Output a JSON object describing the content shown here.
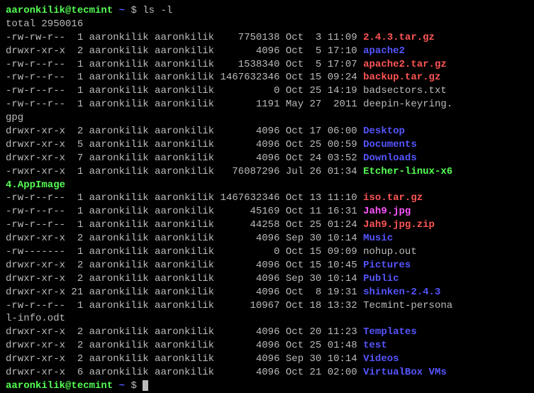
{
  "prompt": {
    "user": "aaronkilik@tecmint",
    "sep": " ",
    "tilde": "~",
    "dollar": " $ "
  },
  "command": "ls -l",
  "total": "total 2950016",
  "rows": [
    {
      "perm": "-rw-rw-r--",
      "links": " 1",
      "owner": "aaronkilik",
      "group": "aaronkilik",
      "size": "   7750138",
      "date": "Oct  3 11:09",
      "file": "2.4.3.tar.gz",
      "cls": "name-red"
    },
    {
      "perm": "drwxr-xr-x",
      "links": " 2",
      "owner": "aaronkilik",
      "group": "aaronkilik",
      "size": "      4096",
      "date": "Oct  5 17:10",
      "file": "apache2",
      "cls": "name-blue"
    },
    {
      "perm": "-rw-r--r--",
      "links": " 1",
      "owner": "aaronkilik",
      "group": "aaronkilik",
      "size": "   1538340",
      "date": "Oct  5 17:07",
      "file": "apache2.tar.gz",
      "cls": "name-red"
    },
    {
      "perm": "-rw-r--r--",
      "links": " 1",
      "owner": "aaronkilik",
      "group": "aaronkilik",
      "size": "1467632346",
      "date": "Oct 15 09:24",
      "file": "backup.tar.gz",
      "cls": "name-red"
    },
    {
      "perm": "-rw-r--r--",
      "links": " 1",
      "owner": "aaronkilik",
      "group": "aaronkilik",
      "size": "         0",
      "date": "Oct 25 14:19",
      "file": "badsectors.txt",
      "cls": "name-grey"
    },
    {
      "perm": "-rw-r--r--",
      "links": " 1",
      "owner": "aaronkilik",
      "group": "aaronkilik",
      "size": "      1191",
      "date": "May 27  2011",
      "file": "deepin-keyring.",
      "cls": "name-grey",
      "wrap": "gpg",
      "wrapcls": "name-grey"
    },
    {
      "perm": "drwxr-xr-x",
      "links": " 2",
      "owner": "aaronkilik",
      "group": "aaronkilik",
      "size": "      4096",
      "date": "Oct 17 06:00",
      "file": "Desktop",
      "cls": "name-blue"
    },
    {
      "perm": "drwxr-xr-x",
      "links": " 5",
      "owner": "aaronkilik",
      "group": "aaronkilik",
      "size": "      4096",
      "date": "Oct 25 00:59",
      "file": "Documents",
      "cls": "name-blue"
    },
    {
      "perm": "drwxr-xr-x",
      "links": " 7",
      "owner": "aaronkilik",
      "group": "aaronkilik",
      "size": "      4096",
      "date": "Oct 24 03:52",
      "file": "Downloads",
      "cls": "name-blue"
    },
    {
      "perm": "-rwxr-xr-x",
      "links": " 1",
      "owner": "aaronkilik",
      "group": "aaronkilik",
      "size": "  76087296",
      "date": "Jul 26 01:34",
      "file": "Etcher-linux-x6",
      "cls": "name-green",
      "wrap": "4.AppImage",
      "wrapcls": "name-green"
    },
    {
      "perm": "-rw-r--r--",
      "links": " 1",
      "owner": "aaronkilik",
      "group": "aaronkilik",
      "size": "1467632346",
      "date": "Oct 13 11:10",
      "file": "iso.tar.gz",
      "cls": "name-red"
    },
    {
      "perm": "-rw-r--r--",
      "links": " 1",
      "owner": "aaronkilik",
      "group": "aaronkilik",
      "size": "     45169",
      "date": "Oct 11 16:31",
      "file": "Jah9.jpg",
      "cls": "name-magenta"
    },
    {
      "perm": "-rw-r--r--",
      "links": " 1",
      "owner": "aaronkilik",
      "group": "aaronkilik",
      "size": "     44258",
      "date": "Oct 25 01:24",
      "file": "Jah9.jpg.zip",
      "cls": "name-red"
    },
    {
      "perm": "drwxr-xr-x",
      "links": " 2",
      "owner": "aaronkilik",
      "group": "aaronkilik",
      "size": "      4096",
      "date": "Sep 30 10:14",
      "file": "Music",
      "cls": "name-blue"
    },
    {
      "perm": "-rw-------",
      "links": " 1",
      "owner": "aaronkilik",
      "group": "aaronkilik",
      "size": "         0",
      "date": "Oct 15 09:09",
      "file": "nohup.out",
      "cls": "name-grey"
    },
    {
      "perm": "drwxr-xr-x",
      "links": " 2",
      "owner": "aaronkilik",
      "group": "aaronkilik",
      "size": "      4096",
      "date": "Oct 15 10:45",
      "file": "Pictures",
      "cls": "name-blue"
    },
    {
      "perm": "drwxr-xr-x",
      "links": " 2",
      "owner": "aaronkilik",
      "group": "aaronkilik",
      "size": "      4096",
      "date": "Sep 30 10:14",
      "file": "Public",
      "cls": "name-blue"
    },
    {
      "perm": "drwxr-xr-x",
      "links": "21",
      "owner": "aaronkilik",
      "group": "aaronkilik",
      "size": "      4096",
      "date": "Oct  8 19:31",
      "file": "shinken-2.4.3",
      "cls": "name-blue"
    },
    {
      "perm": "-rw-r--r--",
      "links": " 1",
      "owner": "aaronkilik",
      "group": "aaronkilik",
      "size": "     10967",
      "date": "Oct 18 13:32",
      "file": "Tecmint-persona",
      "cls": "name-grey",
      "wrap": "l-info.odt",
      "wrapcls": "name-grey"
    },
    {
      "perm": "drwxr-xr-x",
      "links": " 2",
      "owner": "aaronkilik",
      "group": "aaronkilik",
      "size": "      4096",
      "date": "Oct 20 11:23",
      "file": "Templates",
      "cls": "name-blue"
    },
    {
      "perm": "drwxr-xr-x",
      "links": " 2",
      "owner": "aaronkilik",
      "group": "aaronkilik",
      "size": "      4096",
      "date": "Oct 25 01:48",
      "file": "test",
      "cls": "name-blue"
    },
    {
      "perm": "drwxr-xr-x",
      "links": " 2",
      "owner": "aaronkilik",
      "group": "aaronkilik",
      "size": "      4096",
      "date": "Sep 30 10:14",
      "file": "Videos",
      "cls": "name-blue"
    },
    {
      "perm": "drwxr-xr-x",
      "links": " 6",
      "owner": "aaronkilik",
      "group": "aaronkilik",
      "size": "      4096",
      "date": "Oct 21 02:00",
      "file": "VirtualBox VMs",
      "cls": "name-blue"
    }
  ]
}
